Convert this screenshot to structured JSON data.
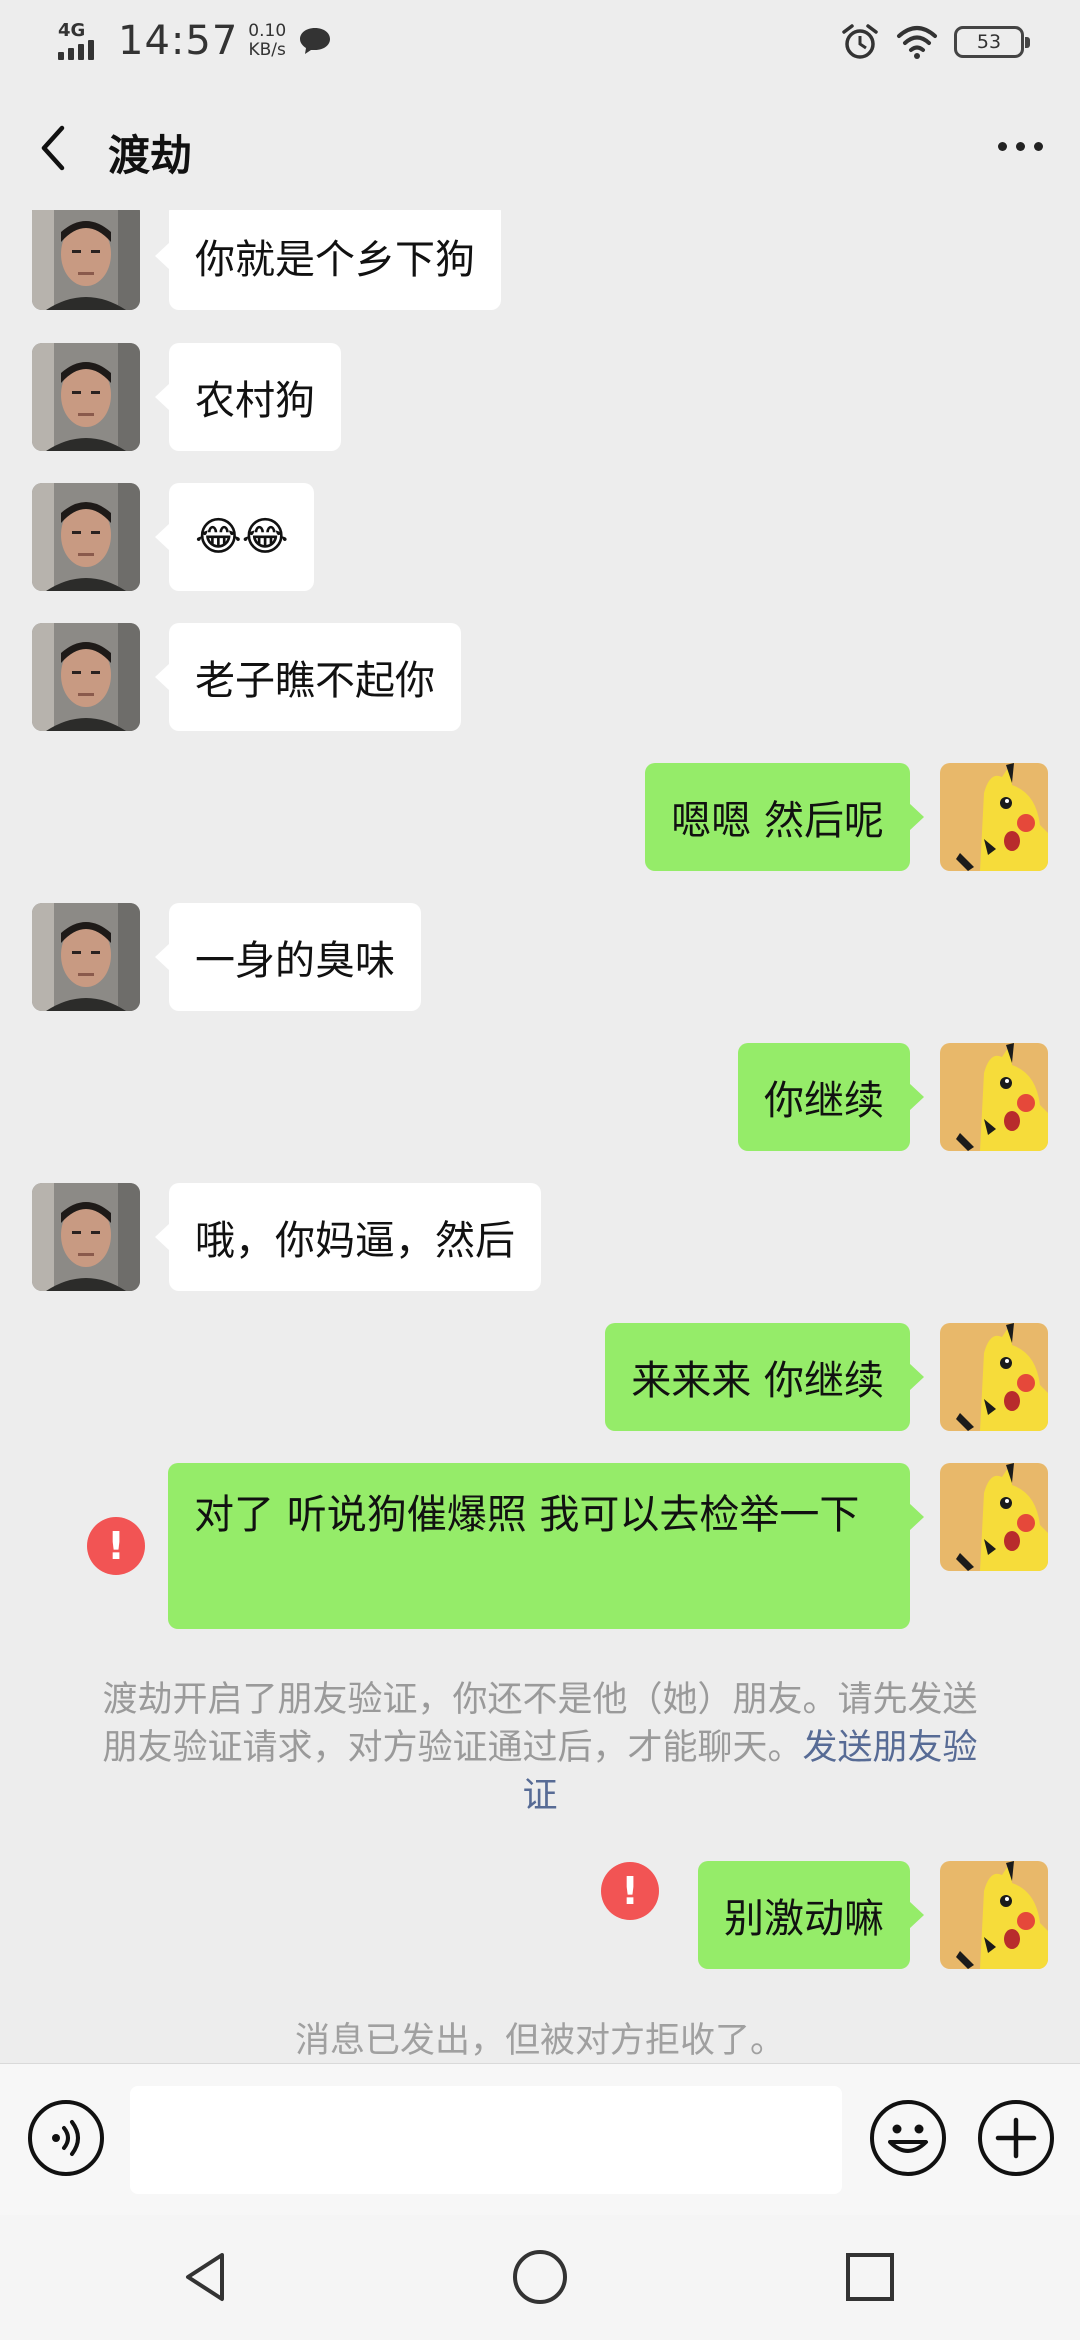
{
  "status_bar": {
    "network": "4G",
    "time": "14:57",
    "speed_value": "0.10",
    "speed_unit": "KB/s",
    "battery": "53"
  },
  "header": {
    "title": "渡劫"
  },
  "messages": [
    {
      "side": "in",
      "text": "你就是个乡下狗"
    },
    {
      "side": "in",
      "text": "农村狗"
    },
    {
      "side": "in",
      "text": "😂😂"
    },
    {
      "side": "in",
      "text": "老子瞧不起你"
    },
    {
      "side": "out",
      "text": "嗯嗯 然后呢"
    },
    {
      "side": "in",
      "text": "一身的臭味"
    },
    {
      "side": "out",
      "text": "你继续"
    },
    {
      "side": "in",
      "text": "哦，你妈逼，然后"
    },
    {
      "side": "out",
      "text": "来来来 你继续"
    },
    {
      "side": "out",
      "text": "对了 听说狗催爆照 我可以去检举一下",
      "failed": true
    },
    {
      "side": "out",
      "text": "别激动嘛",
      "failed": true
    }
  ],
  "system_notice": {
    "text": "渡劫开启了朋友验证，你还不是他（她）朋友。请先发送朋友验证请求，对方验证通过后，才能聊天。",
    "link": "发送朋友验证"
  },
  "system_tip": "消息已发出，但被对方拒收了。",
  "error_mark": "!",
  "colors": {
    "background": "#ededed",
    "outgoing_bubble": "#95ec69",
    "incoming_bubble": "#ffffff",
    "error": "#f25454",
    "link": "#576b95"
  },
  "icons": {
    "back": "chevron-left-icon",
    "more": "more-dots-icon",
    "voice": "voice-icon",
    "emoji": "emoji-icon",
    "plus": "plus-icon",
    "nav_back": "triangle-back-icon",
    "nav_home": "circle-home-icon",
    "nav_recent": "square-recent-icon"
  }
}
